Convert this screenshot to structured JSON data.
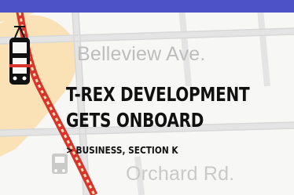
{
  "map": {
    "streets": [
      "Belleview Ave.",
      "Orchard Rd."
    ]
  },
  "headline": {
    "line1": "T-REX DEVELOPMENT",
    "line2": "GETS ONBOARD"
  },
  "section_link": "> BUSINESS, SECTION K",
  "colors": {
    "top_bar": "#4d52c6",
    "rail_line": "#d9342b",
    "area_shade": "#fbe1b6",
    "text": "#111111"
  },
  "icons": [
    "train-icon"
  ]
}
